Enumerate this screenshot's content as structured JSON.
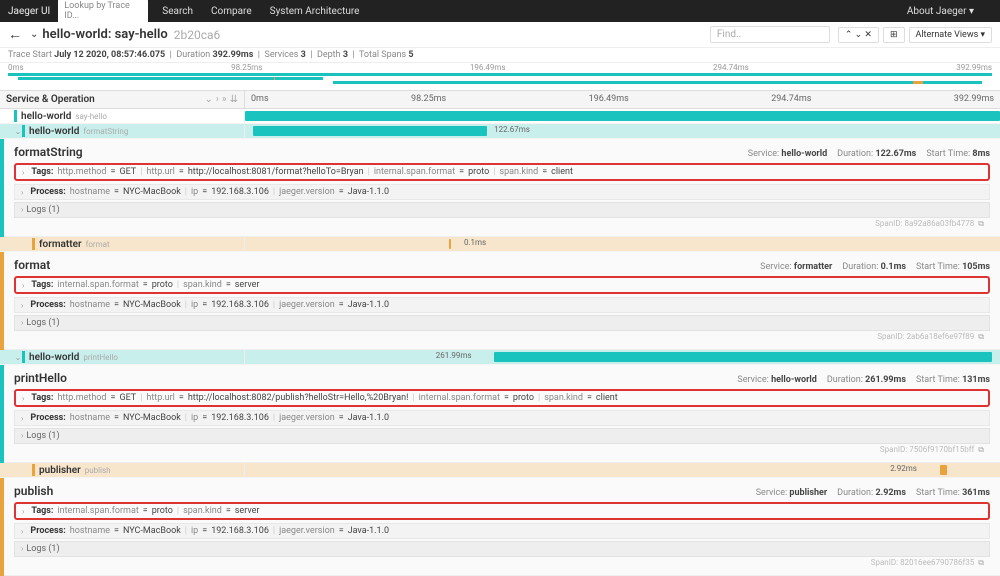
{
  "topbar": {
    "brand": "Jaeger UI",
    "lookup_ph": "Lookup by Trace ID...",
    "links": [
      "Search",
      "Compare",
      "System Architecture"
    ],
    "about": "About Jaeger ▾"
  },
  "header": {
    "title": "hello-world: say-hello",
    "trace_id": "2b20ca6",
    "find_ph": "Find..",
    "nav": "⌃  ⌄  ✕",
    "alt": "Alternate Views ▾",
    "grid": "⊞"
  },
  "meta": {
    "label_start": "Trace Start",
    "start": "July 12 2020, 08:57:46.075",
    "label_dur": "Duration",
    "dur": "392.99ms",
    "label_svc": "Services",
    "svc": "3",
    "label_depth": "Depth",
    "depth": "3",
    "label_spans": "Total Spans",
    "spans": "5"
  },
  "ticks": [
    "0ms",
    "98.25ms",
    "196.49ms",
    "294.74ms",
    "392.99ms"
  ],
  "cols": {
    "left": "Service & Operation",
    "t": [
      "0ms",
      "98.25ms",
      "196.49ms",
      "294.74ms",
      "392.99ms"
    ]
  },
  "spans": [
    {
      "svc": "hello-world",
      "op": "say-hello",
      "color": "#1ac3bd",
      "indent": 0
    },
    {
      "svc": "hello-world",
      "op": "formatString",
      "color": "#1ac3bd",
      "indent": 1
    },
    {
      "svc": "formatter",
      "op": "format",
      "color": "#e8a33d",
      "indent": 2
    },
    {
      "svc": "hello-world",
      "op": "printHello",
      "color": "#1ac3bd",
      "indent": 1
    },
    {
      "svc": "publisher",
      "op": "publish",
      "color": "#e8a33d",
      "indent": 2
    }
  ],
  "details": {
    "formatString": {
      "op": "formatString",
      "svc": "hello-world",
      "dur": "122.67ms",
      "start": "8ms",
      "tags": [
        [
          "http.method",
          "GET"
        ],
        [
          "http.url",
          "http://localhost:8081/format?helloTo=Bryan"
        ],
        [
          "internal.span.format",
          "proto"
        ],
        [
          "span.kind",
          "client"
        ]
      ],
      "process": [
        [
          "hostname",
          "NYC-MacBook"
        ],
        [
          "ip",
          "192.168.3.106"
        ],
        [
          "jaeger.version",
          "Java-1.1.0"
        ]
      ],
      "logs": "Logs (1)",
      "spanid": "8a92a86a03fb4778"
    },
    "format": {
      "op": "format",
      "svc": "formatter",
      "dur": "0.1ms",
      "start": "105ms",
      "tags": [
        [
          "internal.span.format",
          "proto"
        ],
        [
          "span.kind",
          "server"
        ]
      ],
      "process": [
        [
          "hostname",
          "NYC-MacBook"
        ],
        [
          "ip",
          "192.168.3.106"
        ],
        [
          "jaeger.version",
          "Java-1.1.0"
        ]
      ],
      "logs": "Logs (1)",
      "spanid": "2ab6a18ef6e97f89"
    },
    "printHello": {
      "op": "printHello",
      "svc": "hello-world",
      "dur": "261.99ms",
      "start": "131ms",
      "tags": [
        [
          "http.method",
          "GET"
        ],
        [
          "http.url",
          "http://localhost:8082/publish?helloStr=Hello,%20Bryan!"
        ],
        [
          "internal.span.format",
          "proto"
        ],
        [
          "span.kind",
          "client"
        ]
      ],
      "process": [
        [
          "hostname",
          "NYC-MacBook"
        ],
        [
          "ip",
          "192.168.3.106"
        ],
        [
          "jaeger.version",
          "Java-1.1.0"
        ]
      ],
      "logs": "Logs (1)",
      "spanid": "7506f9170bf15bff"
    },
    "publish": {
      "op": "publish",
      "svc": "publisher",
      "dur": "2.92ms",
      "start": "361ms",
      "tags": [
        [
          "internal.span.format",
          "proto"
        ],
        [
          "span.kind",
          "server"
        ]
      ],
      "process": [
        [
          "hostname",
          "NYC-MacBook"
        ],
        [
          "ip",
          "192.168.3.106"
        ],
        [
          "jaeger.version",
          "Java-1.1.0"
        ]
      ],
      "logs": "Logs (1)",
      "spanid": "82016ee6790786f35"
    }
  },
  "bar_labels": {
    "formatString": "122.67ms",
    "format": "0.1ms",
    "printHello": "261.99ms",
    "publish": "2.92ms"
  },
  "labels": {
    "tags": "Tags:",
    "process": "Process:",
    "service": "Service:",
    "duration": "Duration:",
    "starttime": "Start Time:",
    "spanid": "SpanID:"
  }
}
